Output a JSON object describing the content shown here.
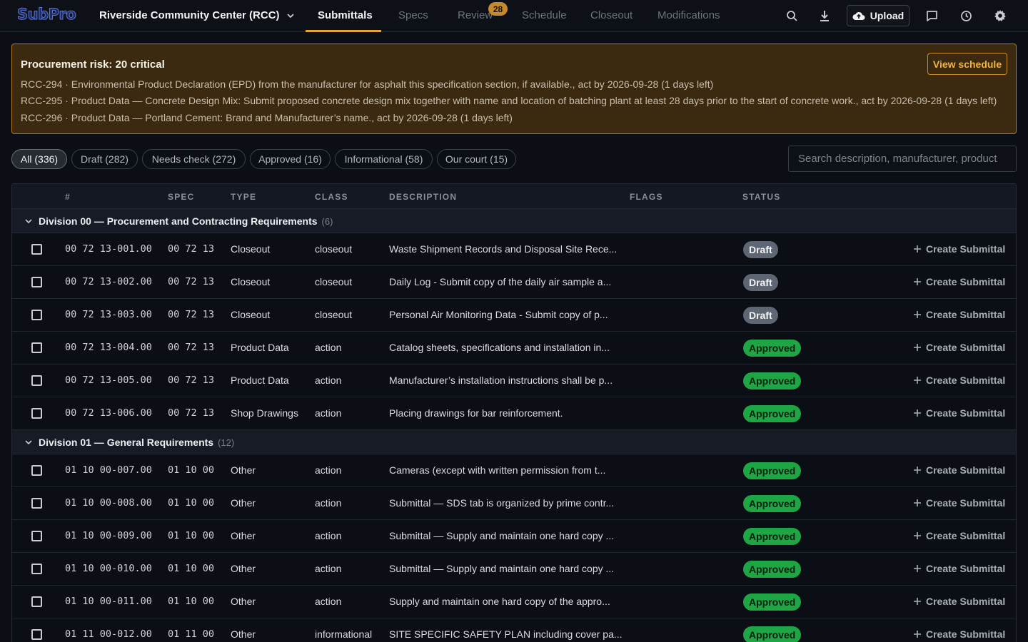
{
  "app": {
    "logo": "SubPro",
    "project": "Riverside Community Center (RCC)"
  },
  "nav": {
    "tabs": [
      {
        "label": "Submittals"
      },
      {
        "label": "Specs"
      },
      {
        "label": "Review"
      },
      {
        "label": "Schedule"
      },
      {
        "label": "Closeout"
      },
      {
        "label": "Modifications"
      }
    ],
    "active_tab": "Submittals",
    "review_badge": "28",
    "upload_label": "Upload",
    "icons": [
      "search-icon",
      "download-icon",
      "cloud-upload-icon",
      "comment-icon",
      "history-icon",
      "gear-icon"
    ]
  },
  "alert": {
    "title": "Procurement risk: 20 critical",
    "lines": [
      "RCC-294 · Environmental Product Declaration (EPD) from the manufacturer for asphalt this specification section, if available., act by 2026-09-28 (1 days left)",
      "RCC-295 · Product Data — Concrete Design Mix: Submit proposed concrete design mix together with name and location of batching plant at least 28 days prior to the start of concrete work., act by 2026-09-28 (1 days left)",
      "RCC-296 · Product Data — Portland Cement: Brand and Manufacturer’s name., act by 2026-09-28 (1 days left)"
    ],
    "button": "View schedule"
  },
  "filters": {
    "chips": [
      {
        "label": "All (336)"
      },
      {
        "label": "Draft (282)"
      },
      {
        "label": "Needs check (272)"
      },
      {
        "label": "Approved (16)"
      },
      {
        "label": "Informational (58)"
      },
      {
        "label": "Our court (15)"
      }
    ],
    "active": "All (336)",
    "search_placeholder": "Search description, manufacturer, product"
  },
  "table": {
    "columns": [
      "#",
      "SPEC",
      "TYPE",
      "CLASS",
      "DESCRIPTION",
      "FLAGS",
      "STATUS"
    ],
    "action_label": "Create Submittal",
    "groups": [
      {
        "name": "Division 00 — Procurement and Contracting Requirements",
        "count": "(6)",
        "rows": [
          {
            "num": "00 72 13-001.00",
            "spec": "00 72 13",
            "type": "Closeout",
            "class": "closeout",
            "desc": "Waste Shipment Records and Disposal Site Rece...",
            "status": "Draft"
          },
          {
            "num": "00 72 13-002.00",
            "spec": "00 72 13",
            "type": "Closeout",
            "class": "closeout",
            "desc": "Daily Log - Submit copy of the daily air sample a...",
            "status": "Draft"
          },
          {
            "num": "00 72 13-003.00",
            "spec": "00 72 13",
            "type": "Closeout",
            "class": "closeout",
            "desc": "Personal Air Monitoring Data - Submit copy of p...",
            "status": "Draft"
          },
          {
            "num": "00 72 13-004.00",
            "spec": "00 72 13",
            "type": "Product Data",
            "class": "action",
            "desc": "Catalog sheets, specifications and installation in...",
            "status": "Approved"
          },
          {
            "num": "00 72 13-005.00",
            "spec": "00 72 13",
            "type": "Product Data",
            "class": "action",
            "desc": "Manufacturer’s installation instructions shall be p...",
            "status": "Approved"
          },
          {
            "num": "00 72 13-006.00",
            "spec": "00 72 13",
            "type": "Shop Drawings",
            "class": "action",
            "desc": "Placing drawings for bar reinforcement.",
            "status": "Approved"
          }
        ]
      },
      {
        "name": "Division 01 — General Requirements",
        "count": "(12)",
        "rows": [
          {
            "num": "01 10 00-007.00",
            "spec": "01 10 00",
            "type": "Other",
            "class": "action",
            "desc": "Cameras (except with written permission from t...",
            "status": "Approved"
          },
          {
            "num": "01 10 00-008.00",
            "spec": "01 10 00",
            "type": "Other",
            "class": "action",
            "desc": "Submittal — SDS tab is organized by prime contr...",
            "status": "Approved"
          },
          {
            "num": "01 10 00-009.00",
            "spec": "01 10 00",
            "type": "Other",
            "class": "action",
            "desc": "Submittal — Supply and maintain one hard copy ...",
            "status": "Approved"
          },
          {
            "num": "01 10 00-010.00",
            "spec": "01 10 00",
            "type": "Other",
            "class": "action",
            "desc": "Submittal — Supply and maintain one hard copy ...",
            "status": "Approved"
          },
          {
            "num": "01 10 00-011.00",
            "spec": "01 10 00",
            "type": "Other",
            "class": "action",
            "desc": "Supply and maintain one hard copy of the appro...",
            "status": "Approved"
          },
          {
            "num": "01 11 00-012.00",
            "spec": "01 11 00",
            "type": "Other",
            "class": "informational",
            "desc": "SITE SPECIFIC SAFETY PLAN including cover pa...",
            "status": "Approved"
          }
        ]
      }
    ]
  },
  "colors": {
    "accent": "#e3a335",
    "alert_bg": "#3b2a0f",
    "draft": "#5f6673",
    "approved": "#1fa644"
  }
}
